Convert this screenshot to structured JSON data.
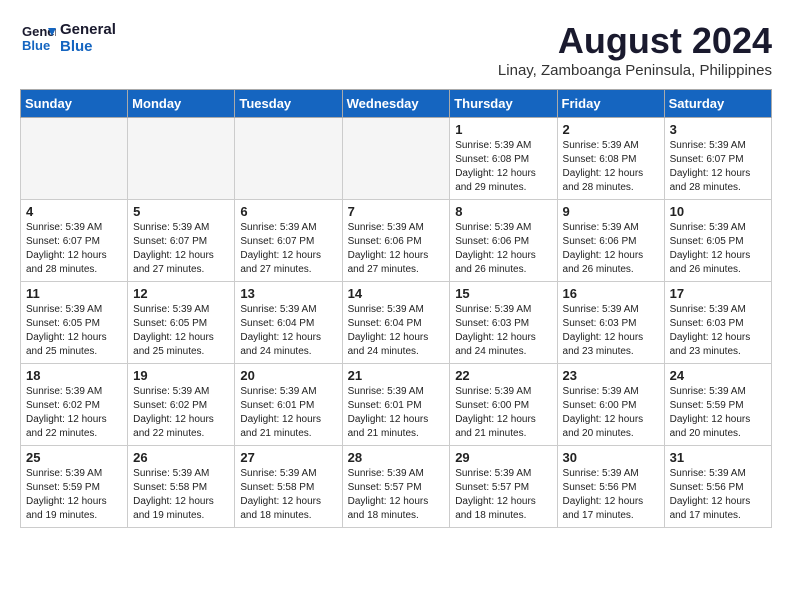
{
  "logo": {
    "line1": "General",
    "line2": "Blue"
  },
  "title": "August 2024",
  "location": "Linay, Zamboanga Peninsula, Philippines",
  "weekdays": [
    "Sunday",
    "Monday",
    "Tuesday",
    "Wednesday",
    "Thursday",
    "Friday",
    "Saturday"
  ],
  "weeks": [
    [
      {
        "day": "",
        "info": ""
      },
      {
        "day": "",
        "info": ""
      },
      {
        "day": "",
        "info": ""
      },
      {
        "day": "",
        "info": ""
      },
      {
        "day": "1",
        "info": "Sunrise: 5:39 AM\nSunset: 6:08 PM\nDaylight: 12 hours\nand 29 minutes."
      },
      {
        "day": "2",
        "info": "Sunrise: 5:39 AM\nSunset: 6:08 PM\nDaylight: 12 hours\nand 28 minutes."
      },
      {
        "day": "3",
        "info": "Sunrise: 5:39 AM\nSunset: 6:07 PM\nDaylight: 12 hours\nand 28 minutes."
      }
    ],
    [
      {
        "day": "4",
        "info": "Sunrise: 5:39 AM\nSunset: 6:07 PM\nDaylight: 12 hours\nand 28 minutes."
      },
      {
        "day": "5",
        "info": "Sunrise: 5:39 AM\nSunset: 6:07 PM\nDaylight: 12 hours\nand 27 minutes."
      },
      {
        "day": "6",
        "info": "Sunrise: 5:39 AM\nSunset: 6:07 PM\nDaylight: 12 hours\nand 27 minutes."
      },
      {
        "day": "7",
        "info": "Sunrise: 5:39 AM\nSunset: 6:06 PM\nDaylight: 12 hours\nand 27 minutes."
      },
      {
        "day": "8",
        "info": "Sunrise: 5:39 AM\nSunset: 6:06 PM\nDaylight: 12 hours\nand 26 minutes."
      },
      {
        "day": "9",
        "info": "Sunrise: 5:39 AM\nSunset: 6:06 PM\nDaylight: 12 hours\nand 26 minutes."
      },
      {
        "day": "10",
        "info": "Sunrise: 5:39 AM\nSunset: 6:05 PM\nDaylight: 12 hours\nand 26 minutes."
      }
    ],
    [
      {
        "day": "11",
        "info": "Sunrise: 5:39 AM\nSunset: 6:05 PM\nDaylight: 12 hours\nand 25 minutes."
      },
      {
        "day": "12",
        "info": "Sunrise: 5:39 AM\nSunset: 6:05 PM\nDaylight: 12 hours\nand 25 minutes."
      },
      {
        "day": "13",
        "info": "Sunrise: 5:39 AM\nSunset: 6:04 PM\nDaylight: 12 hours\nand 24 minutes."
      },
      {
        "day": "14",
        "info": "Sunrise: 5:39 AM\nSunset: 6:04 PM\nDaylight: 12 hours\nand 24 minutes."
      },
      {
        "day": "15",
        "info": "Sunrise: 5:39 AM\nSunset: 6:03 PM\nDaylight: 12 hours\nand 24 minutes."
      },
      {
        "day": "16",
        "info": "Sunrise: 5:39 AM\nSunset: 6:03 PM\nDaylight: 12 hours\nand 23 minutes."
      },
      {
        "day": "17",
        "info": "Sunrise: 5:39 AM\nSunset: 6:03 PM\nDaylight: 12 hours\nand 23 minutes."
      }
    ],
    [
      {
        "day": "18",
        "info": "Sunrise: 5:39 AM\nSunset: 6:02 PM\nDaylight: 12 hours\nand 22 minutes."
      },
      {
        "day": "19",
        "info": "Sunrise: 5:39 AM\nSunset: 6:02 PM\nDaylight: 12 hours\nand 22 minutes."
      },
      {
        "day": "20",
        "info": "Sunrise: 5:39 AM\nSunset: 6:01 PM\nDaylight: 12 hours\nand 21 minutes."
      },
      {
        "day": "21",
        "info": "Sunrise: 5:39 AM\nSunset: 6:01 PM\nDaylight: 12 hours\nand 21 minutes."
      },
      {
        "day": "22",
        "info": "Sunrise: 5:39 AM\nSunset: 6:00 PM\nDaylight: 12 hours\nand 21 minutes."
      },
      {
        "day": "23",
        "info": "Sunrise: 5:39 AM\nSunset: 6:00 PM\nDaylight: 12 hours\nand 20 minutes."
      },
      {
        "day": "24",
        "info": "Sunrise: 5:39 AM\nSunset: 5:59 PM\nDaylight: 12 hours\nand 20 minutes."
      }
    ],
    [
      {
        "day": "25",
        "info": "Sunrise: 5:39 AM\nSunset: 5:59 PM\nDaylight: 12 hours\nand 19 minutes."
      },
      {
        "day": "26",
        "info": "Sunrise: 5:39 AM\nSunset: 5:58 PM\nDaylight: 12 hours\nand 19 minutes."
      },
      {
        "day": "27",
        "info": "Sunrise: 5:39 AM\nSunset: 5:58 PM\nDaylight: 12 hours\nand 18 minutes."
      },
      {
        "day": "28",
        "info": "Sunrise: 5:39 AM\nSunset: 5:57 PM\nDaylight: 12 hours\nand 18 minutes."
      },
      {
        "day": "29",
        "info": "Sunrise: 5:39 AM\nSunset: 5:57 PM\nDaylight: 12 hours\nand 18 minutes."
      },
      {
        "day": "30",
        "info": "Sunrise: 5:39 AM\nSunset: 5:56 PM\nDaylight: 12 hours\nand 17 minutes."
      },
      {
        "day": "31",
        "info": "Sunrise: 5:39 AM\nSunset: 5:56 PM\nDaylight: 12 hours\nand 17 minutes."
      }
    ]
  ]
}
